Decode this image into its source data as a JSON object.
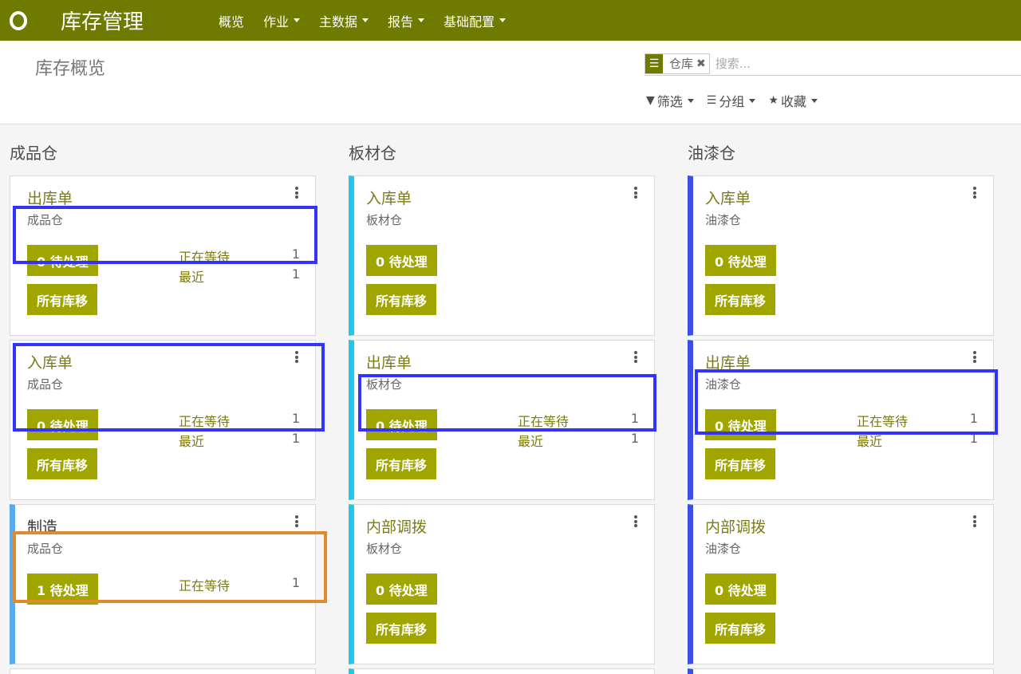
{
  "app": {
    "title": "库存管理"
  },
  "nav": {
    "items": [
      {
        "label": "概览",
        "dropdown": false
      },
      {
        "label": "作业",
        "dropdown": true
      },
      {
        "label": "主数据",
        "dropdown": true
      },
      {
        "label": "报告",
        "dropdown": true
      },
      {
        "label": "基础配置",
        "dropdown": true
      }
    ]
  },
  "breadcrumb": {
    "title": "库存概览"
  },
  "search": {
    "facet_value": "仓库",
    "placeholder": "搜索..."
  },
  "filters": {
    "filter_label": "筛选",
    "group_label": "分组",
    "favorite_label": "收藏"
  },
  "colors": {
    "navbar": "#6e7b00",
    "button": "#a0a500",
    "title_text": "#7c7b13",
    "accent_cyan": "#22c8e8",
    "accent_blue": "#3b4fe8",
    "accent_lightblue": "#5ba8ef",
    "annotation_blue": "#3333ff",
    "annotation_orange": "#e08a2c"
  },
  "columns": [
    {
      "title": "成品仓",
      "cards": [
        {
          "title": "出库单",
          "subtitle": "成品仓",
          "primary": "0 待处理",
          "secondary": "所有库移",
          "stats": [
            {
              "label": "正在等待",
              "value": "1"
            },
            {
              "label": "最近",
              "value": "1"
            }
          ]
        },
        {
          "title": "入库单",
          "subtitle": "成品仓",
          "primary": "0 待处理",
          "secondary": "所有库移",
          "stats": [
            {
              "label": "正在等待",
              "value": "1"
            },
            {
              "label": "最近",
              "value": "1"
            }
          ]
        },
        {
          "title": "制造",
          "subtitle": "成品仓",
          "primary": "1 待处理",
          "stats": [
            {
              "label": "正在等待",
              "value": "1"
            }
          ]
        }
      ]
    },
    {
      "title": "板材仓",
      "cards": [
        {
          "title": "入库单",
          "subtitle": "板材仓",
          "primary": "0 待处理",
          "secondary": "所有库移"
        },
        {
          "title": "出库单",
          "subtitle": "板材仓",
          "primary": "0 待处理",
          "secondary": "所有库移",
          "stats": [
            {
              "label": "正在等待",
              "value": "1"
            },
            {
              "label": "最近",
              "value": "1"
            }
          ]
        },
        {
          "title": "内部调拨",
          "subtitle": "板材仓",
          "primary": "0 待处理",
          "secondary": "所有库移"
        }
      ]
    },
    {
      "title": "油漆仓",
      "cards": [
        {
          "title": "入库单",
          "subtitle": "油漆仓",
          "primary": "0 待处理",
          "secondary": "所有库移"
        },
        {
          "title": "出库单",
          "subtitle": "油漆仓",
          "primary": "0 待处理",
          "secondary": "所有库移",
          "stats": [
            {
              "label": "正在等待",
              "value": "1"
            },
            {
              "label": "最近",
              "value": "1"
            }
          ]
        },
        {
          "title": "内部调拨",
          "subtitle": "油漆仓",
          "primary": "0 待处理",
          "secondary": "所有库移"
        }
      ]
    }
  ]
}
